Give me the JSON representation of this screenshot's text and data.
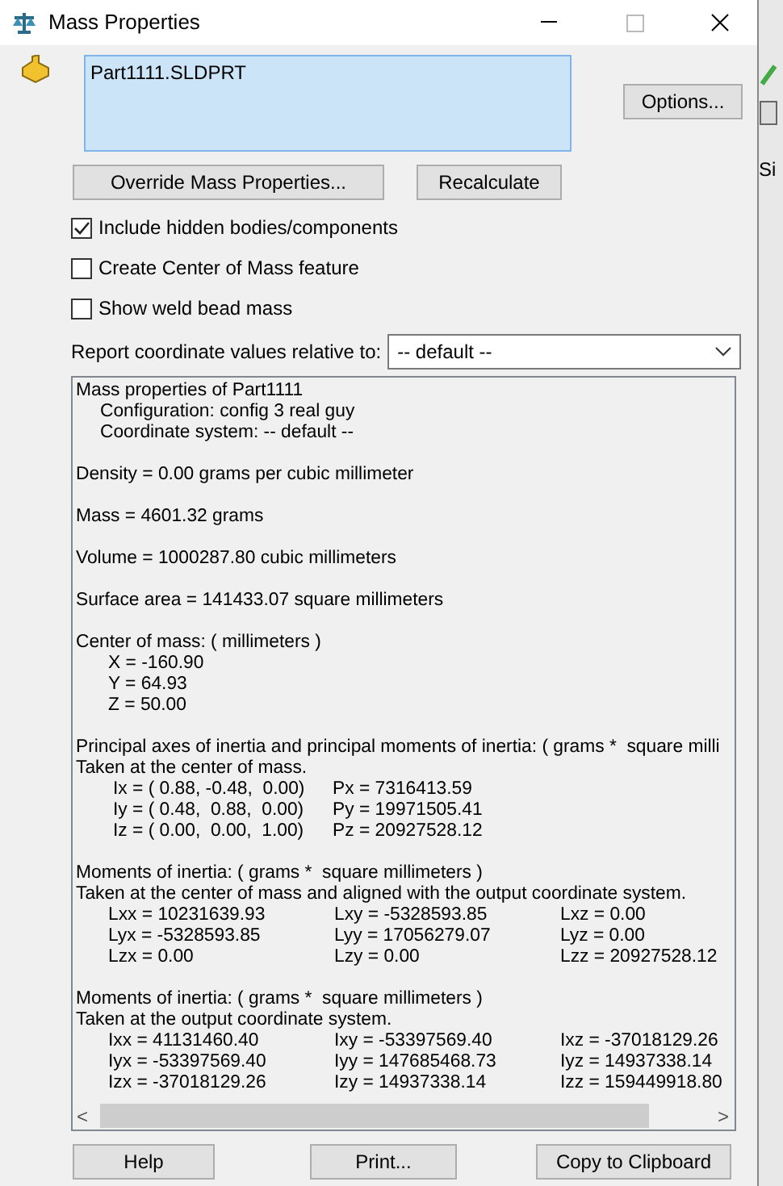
{
  "window": {
    "title": "Mass Properties"
  },
  "selection": {
    "items": [
      "Part1111.SLDPRT"
    ]
  },
  "buttons_top": [
    {
      "label": "Options..."
    },
    {
      "label": "Override Mass Properties..."
    },
    {
      "label": "Recalculate"
    }
  ],
  "options": [
    {
      "label": "Include hidden bodies/components",
      "checked": true
    },
    {
      "label": "Create Center of Mass feature",
      "checked": false
    },
    {
      "label": "Show weld bead mass",
      "checked": false
    }
  ],
  "coordinate": {
    "label": "Report coordinate values relative to:",
    "value": "-- default --"
  },
  "report": [
    {
      "kind": "heading",
      "cells": [
        "Mass properties of Part1111"
      ]
    },
    {
      "kind": "sub",
      "cells": [
        "Configuration: config 3 real guy"
      ]
    },
    {
      "kind": "sub",
      "cells": [
        "Coordinate system: -- default --"
      ]
    },
    {
      "kind": "gap"
    },
    {
      "kind": "heading",
      "cells": [
        "Density = 0.00 grams per cubic millimeter"
      ]
    },
    {
      "kind": "gap"
    },
    {
      "kind": "heading",
      "cells": [
        "Mass = 4601.32 grams"
      ]
    },
    {
      "kind": "gap"
    },
    {
      "kind": "heading",
      "cells": [
        "Volume = 1000287.80 cubic millimeters"
      ]
    },
    {
      "kind": "gap"
    },
    {
      "kind": "heading",
      "cells": [
        "Surface area = 141433.07 square millimeters"
      ]
    },
    {
      "kind": "gap"
    },
    {
      "kind": "heading",
      "cells": [
        "Center of mass: ( millimeters )"
      ]
    },
    {
      "kind": "value",
      "cells": [
        "X = -160.90"
      ]
    },
    {
      "kind": "value",
      "cells": [
        "Y = 64.93"
      ]
    },
    {
      "kind": "value",
      "cells": [
        "Z = 50.00"
      ]
    },
    {
      "kind": "gap"
    },
    {
      "kind": "heading",
      "cells": [
        "Principal axes of inertia and principal moments of inertia: ( grams *  square milli"
      ]
    },
    {
      "kind": "heading",
      "cells": [
        "Taken at the center of mass."
      ]
    },
    {
      "kind": "axes",
      "cells": [
        "Ix = ( 0.88, -0.48,  0.00)",
        "Px = 7316413.59"
      ]
    },
    {
      "kind": "axes",
      "cells": [
        "Iy = ( 0.48,  0.88,  0.00)",
        "Py = 19971505.41"
      ]
    },
    {
      "kind": "axes",
      "cells": [
        "Iz = ( 0.00,  0.00,  1.00)",
        "Pz = 20927528.12"
      ]
    },
    {
      "kind": "gap"
    },
    {
      "kind": "heading",
      "cells": [
        "Moments of inertia: ( grams *  square millimeters )"
      ]
    },
    {
      "kind": "heading",
      "cells": [
        "Taken at the center of mass and aligned with the output coordinate system."
      ]
    },
    {
      "kind": "matrix",
      "cells": [
        "Lxx = 10231639.93",
        "Lxy = -5328593.85",
        "Lxz = 0.00"
      ]
    },
    {
      "kind": "matrix",
      "cells": [
        "Lyx = -5328593.85",
        "Lyy = 17056279.07",
        "Lyz = 0.00"
      ]
    },
    {
      "kind": "matrix",
      "cells": [
        "Lzx = 0.00",
        "Lzy = 0.00",
        "Lzz = 20927528.12"
      ]
    },
    {
      "kind": "gap"
    },
    {
      "kind": "heading",
      "cells": [
        "Moments of inertia: ( grams *  square millimeters )"
      ]
    },
    {
      "kind": "heading",
      "cells": [
        "Taken at the output coordinate system."
      ]
    },
    {
      "kind": "matrix",
      "cells": [
        "Ixx = 41131460.40",
        "Ixy = -53397569.40",
        "Ixz = -37018129.26"
      ]
    },
    {
      "kind": "matrix",
      "cells": [
        "Iyx = -53397569.40",
        "Iyy = 147685468.73",
        "Iyz = 14937338.14"
      ]
    },
    {
      "kind": "matrix",
      "cells": [
        "Izx = -37018129.26",
        "Izy = 14937338.14",
        "Izz = 159449918.80"
      ]
    }
  ],
  "scroll_arrows": [
    "<",
    ">"
  ],
  "buttons_bottom": [
    {
      "label": "Help"
    },
    {
      "label": "Print..."
    },
    {
      "label": "Copy to Clipboard"
    }
  ],
  "background_window": {
    "tab": "Si"
  }
}
